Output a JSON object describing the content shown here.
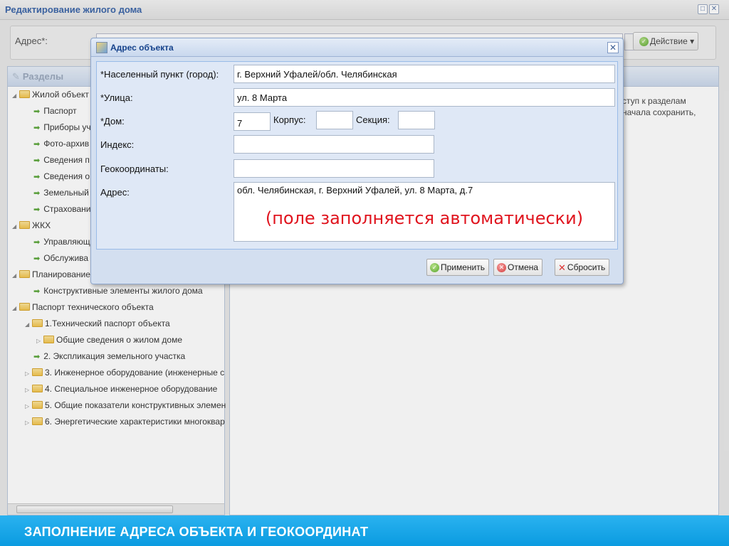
{
  "window": {
    "title": "Редактирование жилого дома"
  },
  "address_bar": {
    "label": "Адрес*:",
    "value": "",
    "action_label": "Действие"
  },
  "sections": {
    "title": "Разделы",
    "items": [
      {
        "label": "Жилой объект",
        "kind": "folder",
        "level": 0
      },
      {
        "label": "Паспорт",
        "kind": "leaf",
        "level": 1
      },
      {
        "label": "Приборы уч",
        "kind": "leaf",
        "level": 1
      },
      {
        "label": "Фото-архив",
        "kind": "leaf",
        "level": 1
      },
      {
        "label": "Сведения п",
        "kind": "leaf",
        "level": 1
      },
      {
        "label": "Сведения о",
        "kind": "leaf",
        "level": 1
      },
      {
        "label": "Земельный",
        "kind": "leaf",
        "level": 1
      },
      {
        "label": "Страховани",
        "kind": "leaf",
        "level": 1
      },
      {
        "label": "ЖКХ",
        "kind": "folder",
        "level": 0
      },
      {
        "label": "Управляющ",
        "kind": "leaf",
        "level": 1
      },
      {
        "label": "Обслужива",
        "kind": "leaf",
        "level": 1
      },
      {
        "label": "Планирование",
        "kind": "folder",
        "level": 0
      },
      {
        "label": "Конструктивные элементы жилого дома",
        "kind": "leaf",
        "level": 1
      },
      {
        "label": "Паспорт технического объекта",
        "kind": "folder",
        "level": 0
      },
      {
        "label": "1.Технический паспорт объекта",
        "kind": "folder",
        "level": 1
      },
      {
        "label": "Общие сведения о жилом доме",
        "kind": "folder-collapsed",
        "level": 2
      },
      {
        "label": "2. Экспликация земельного участка",
        "kind": "leaf",
        "level": 1
      },
      {
        "label": "3. Инженерное оборудование (инженерные с",
        "kind": "folder-collapsed",
        "level": 1
      },
      {
        "label": "4. Специальное инженерное оборудование",
        "kind": "folder-collapsed",
        "level": 1
      },
      {
        "label": "5. Общие показатели конструктивных элемен",
        "kind": "folder-collapsed",
        "level": 1
      },
      {
        "label": "6. Энергетические характеристики многоквар",
        "kind": "folder-collapsed",
        "level": 1
      }
    ]
  },
  "hint_text": "ступ к разделам\nначала сохранить,",
  "dialog": {
    "title": "Адрес объекта",
    "city_label": "*Населенный пункт (город):",
    "city_value": "г. Верхний Уфалей/обл. Челябинская",
    "street_label": "*Улица:",
    "street_value": "ул. 8 Марта",
    "house_label": "*Дом:",
    "house_value": "7",
    "building_label": "Корпус:",
    "building_value": "",
    "section_label": "Секция:",
    "section_value": "",
    "index_label": "Индекс:",
    "index_value": "",
    "geo_label": "Геокоординаты:",
    "geo_value": "",
    "address_label": "Адрес:",
    "address_value": "обл. Челябинская, г. Верхний Уфалей, ул. 8 Марта, д.7",
    "auto_note": "(поле заполняется автоматически)",
    "apply_label": "Применить",
    "cancel_label": "Отмена",
    "reset_label": "Сбросить"
  },
  "banner": {
    "text": "ЗАПОЛНЕНИЕ АДРЕСА ОБЪЕКТА И ГЕОКООРДИНАТ"
  },
  "colors": {
    "banner": "#0a9be0",
    "note": "#e0141e",
    "title": "#15428b"
  }
}
